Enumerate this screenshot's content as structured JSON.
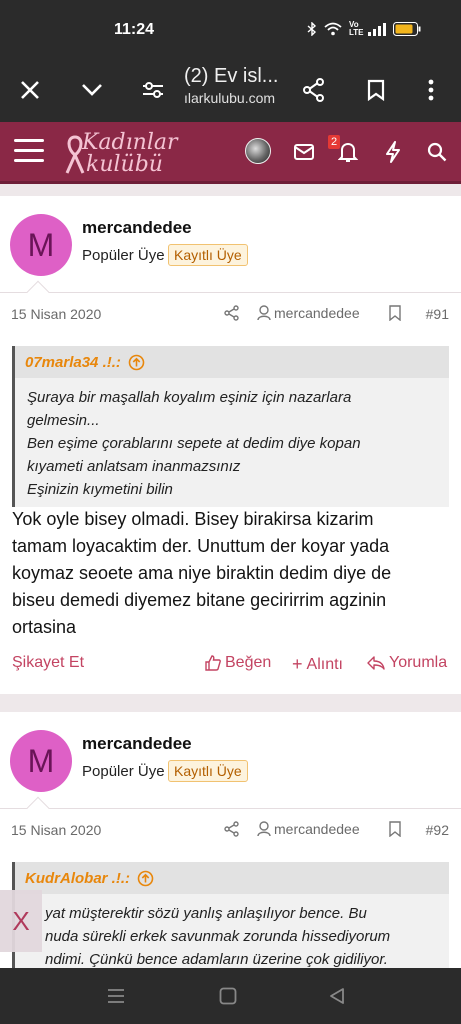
{
  "status_bar": {
    "time": "11:24",
    "network_label": "Vo LTE"
  },
  "browser": {
    "title": "(2) Ev isl...",
    "url": "ılarkulubu.com"
  },
  "site": {
    "logo_line1": "Kadınlar",
    "logo_line2": "kulübü",
    "notification_count": "2",
    "brand_color": "#8a2846"
  },
  "posts": [
    {
      "avatar_letter": "M",
      "username": "mercandedee",
      "user_title": "Popüler Üye",
      "user_badge": "Kayıtlı Üye",
      "date": "15 Nisan 2020",
      "meta_user": "mercandedee",
      "number": "#91",
      "quote": {
        "author": "07marla34 .!.:",
        "lines": [
          "Şuraya bir maşallah koyalım eşiniz için nazarlara",
          "gelmesin...",
          "Ben eşime çorablarını sepete at dedim diye kopan",
          "kıyameti anlatsam inanmazsınız",
          "Eşinizin kıymetini bilin"
        ]
      },
      "text_lines": [
        "Yok oyle bisey olmadi. Bisey birakirsa kizarim",
        "tamam loyacaktim der. Unuttum der koyar yada",
        "koymaz seoete ama niye biraktin dedim diye de",
        "biseu demedi diyemez bitane gecirirrim agzinin",
        "ortasina"
      ],
      "actions": {
        "report": "Şikayet Et",
        "like": "Beğen",
        "quote": "Alıntı",
        "reply": "Yorumla"
      }
    },
    {
      "avatar_letter": "M",
      "username": "mercandedee",
      "user_title": "Popüler Üye",
      "user_badge": "Kayıtlı Üye",
      "date": "15 Nisan 2020",
      "meta_user": "mercandedee",
      "number": "#92",
      "quote": {
        "author": "KudrAlobar .!.:",
        "lines": [
          "yat müşterektir sözü yanlış anlaşılıyor bence. Bu",
          "nuda sürekli erkek savunmak zorunda hissediyorum",
          "ndimi. Çünkü bence adamların üzerine çok gidiliyor."
        ]
      }
    }
  ],
  "floating_close_label": "X"
}
